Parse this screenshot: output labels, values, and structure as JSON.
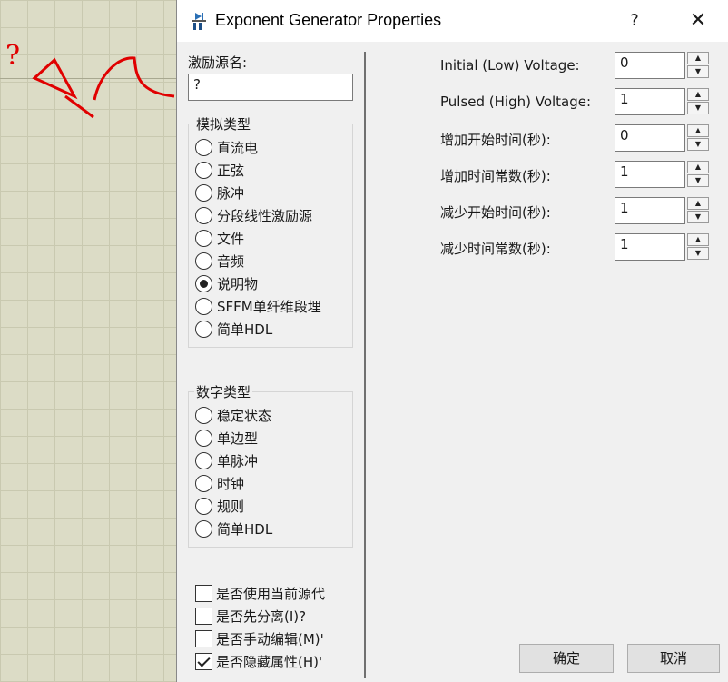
{
  "window": {
    "title": "Exponent Generator Properties",
    "help_glyph": "?",
    "close_glyph": "✕"
  },
  "canvas": {
    "annotation_mark": "?"
  },
  "left_panel": {
    "name_label": "激励源名:",
    "name_value": "?",
    "analog_group": {
      "title": "模拟类型",
      "options": [
        {
          "label": "直流电",
          "selected": false
        },
        {
          "label": "正弦",
          "selected": false
        },
        {
          "label": "脉冲",
          "selected": false
        },
        {
          "label": "分段线性激励源",
          "selected": false
        },
        {
          "label": "文件",
          "selected": false
        },
        {
          "label": "音频",
          "selected": false
        },
        {
          "label": "说明物",
          "selected": true
        },
        {
          "label": "SFFM单纤维段埋",
          "selected": false
        },
        {
          "label": "简单HDL",
          "selected": false
        }
      ]
    },
    "digital_group": {
      "title": "数字类型",
      "options": [
        {
          "label": "稳定状态",
          "selected": false
        },
        {
          "label": "单边型",
          "selected": false
        },
        {
          "label": "单脉冲",
          "selected": false
        },
        {
          "label": "时钟",
          "selected": false
        },
        {
          "label": "规则",
          "selected": false
        },
        {
          "label": "简单HDL",
          "selected": false
        }
      ]
    },
    "checkboxes": [
      {
        "label": "是否使用当前源代",
        "checked": false
      },
      {
        "label": "是否先分离(I)?",
        "checked": false
      },
      {
        "label": "是否手动编辑(M)'",
        "checked": false
      },
      {
        "label": "是否隐藏属性(H)'",
        "checked": true
      }
    ]
  },
  "parameters": [
    {
      "label": "Initial (Low) Voltage:",
      "value": "0"
    },
    {
      "label": "Pulsed (High) Voltage:",
      "value": "1"
    },
    {
      "label": "增加开始时间(秒):",
      "value": "0"
    },
    {
      "label": "增加时间常数(秒):",
      "value": "1"
    },
    {
      "label": "减少开始时间(秒):",
      "value": "1"
    },
    {
      "label": "减少时间常数(秒):",
      "value": "1"
    }
  ],
  "spin_up_glyph": "▲",
  "spin_down_glyph": "▼",
  "buttons": {
    "ok": "确定",
    "cancel": "取消"
  },
  "colors": {
    "annotation": "#e00000",
    "dialog_bg": "#f0f0f0",
    "canvas_bg": "#dcdcc6"
  }
}
